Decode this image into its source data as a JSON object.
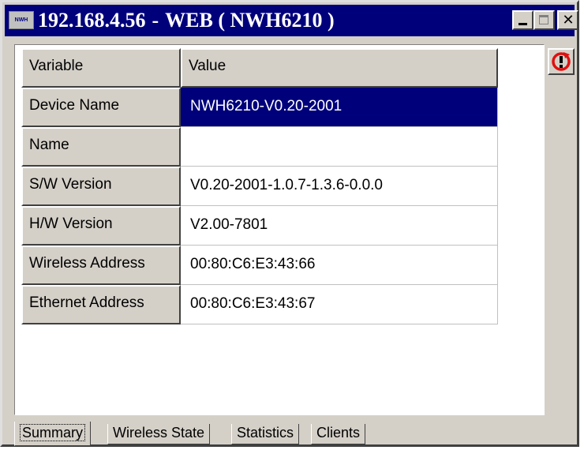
{
  "window": {
    "icon_text": "NWH",
    "title_ip": "192.168.4.56",
    "title_sep": "-",
    "title_name": "WEB ( NWH6210 )",
    "buttons": [
      "minimize-icon",
      "maximize-icon",
      "close-icon"
    ],
    "close_glyph": "✕"
  },
  "table": {
    "header": {
      "variable": "Variable",
      "value": "Value"
    },
    "rows": [
      {
        "label": "Device Name",
        "value": "NWH6210-V0.20-2001",
        "selected": true
      },
      {
        "label": "Name",
        "value": ""
      },
      {
        "label": "S/W Version",
        "value": "V0.20-2001-1.0.7-1.3.6-0.0.0"
      },
      {
        "label": "H/W Version",
        "value": "V2.00-7801"
      },
      {
        "label": "Wireless Address",
        "value": "00:80:C6:E3:43:66"
      },
      {
        "label": "Ethernet Address",
        "value": "00:80:C6:E3:43:67"
      }
    ]
  },
  "refresh_button": {
    "icon": "refresh-icon"
  },
  "tabs": [
    {
      "label": "Summary",
      "active": true
    },
    {
      "label": "Wireless State"
    },
    {
      "label": "Statistics"
    },
    {
      "label": "Clients"
    }
  ],
  "colors": {
    "titlebar": "#00007b",
    "selection": "#00007b",
    "face": "#d4d0c8",
    "refresh_icon": "#e01010"
  }
}
